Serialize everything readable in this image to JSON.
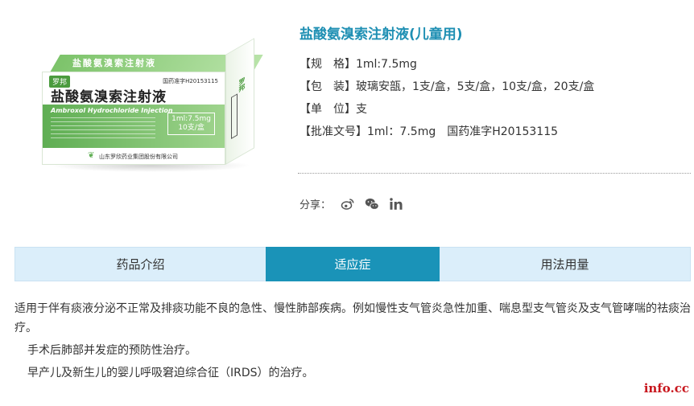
{
  "product": {
    "title": "盐酸氨溴索注射液(儿童用)",
    "image": {
      "brand": "罗邦",
      "top_text": "盐酸氨溴索注射液",
      "approval": "国药准字H20153115",
      "cn_name": "盐酸氨溴索注射液",
      "en_name": "Ambroxol Hydrochloride Injection",
      "spec_line1": "1ml:7.5mg",
      "spec_line2": "10支/盒",
      "manufacturer": "山东罗欣药业集团股份有限公司",
      "side_brand": "罗邦"
    },
    "info": [
      {
        "label": "【规　格】",
        "value": "1ml:7.5mg"
      },
      {
        "label": "【包　装】",
        "value": "玻璃安瓿，1支/盒，5支/盒，10支/盒，20支/盒"
      },
      {
        "label": "【单　位】",
        "value": "支"
      },
      {
        "label": "【批准文号】",
        "value": "1ml：7.5mg　国药准字H20153115"
      }
    ]
  },
  "share": {
    "label": "分享：",
    "icons": [
      "weibo-icon",
      "wechat-icon",
      "linkedin-icon"
    ],
    "color": "#555555"
  },
  "tabs": [
    {
      "label": "药品介绍",
      "active": false
    },
    {
      "label": "适应症",
      "active": true
    },
    {
      "label": "用法用量",
      "active": false
    }
  ],
  "content": {
    "paragraphs": [
      "适用于伴有痰液分泌不正常及排痰功能不良的急性、慢性肺部疾病。例如慢性支气管炎急性加重、喘息型支气管炎及支气管哮喘的祛痰治疗。",
      "手术后肺部并发症的预防性治疗。",
      "早产儿及新生儿的婴儿呼吸窘迫综合征（IRDS）的治疗。"
    ]
  },
  "watermark": "info.cc",
  "colors": {
    "accent": "#1a93b8",
    "title": "#1e8fb3",
    "tab_bg": "#dbeefa",
    "watermark": "#c8161d"
  }
}
